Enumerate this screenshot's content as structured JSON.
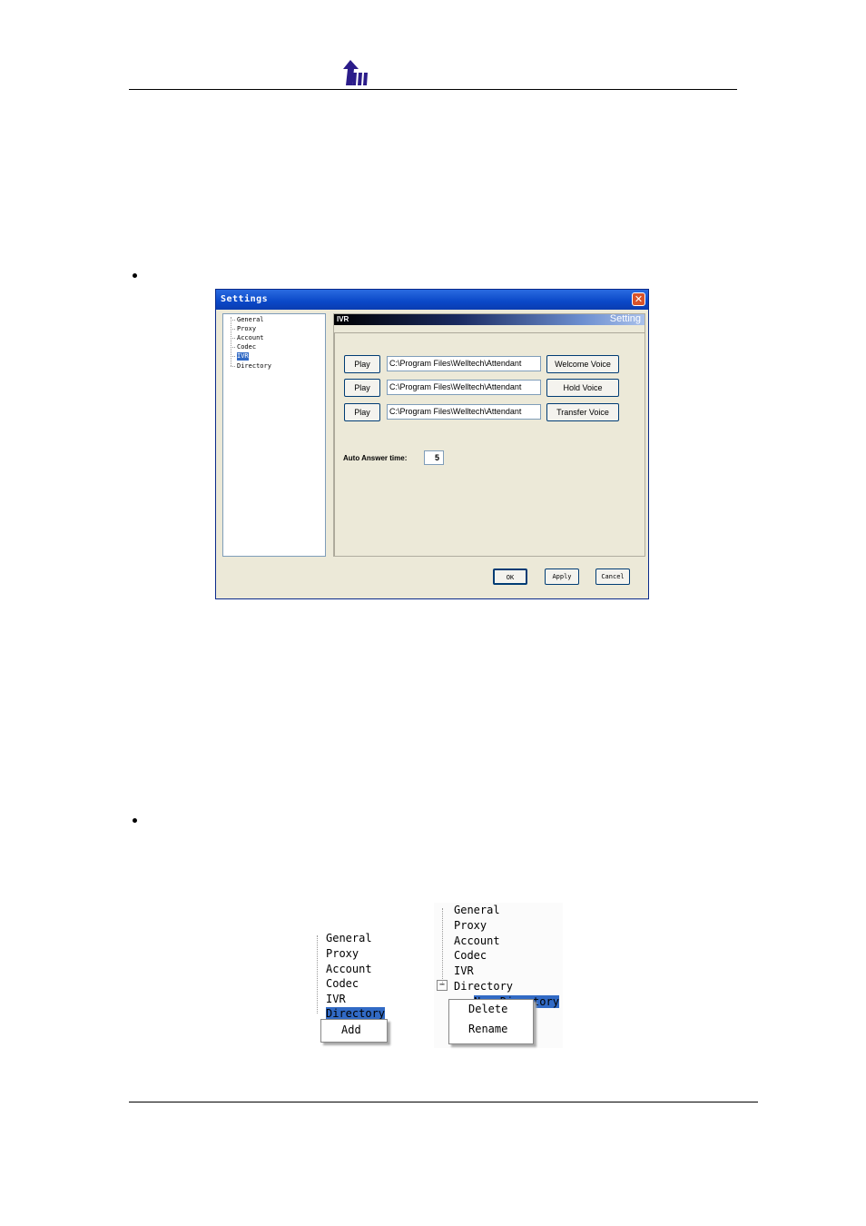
{
  "dialog": {
    "title": "Settings",
    "close_glyph": "✕",
    "tree": [
      "General",
      "Proxy",
      "Account",
      "Codec",
      "IVR",
      "Directory"
    ],
    "selected_tree_item": "IVR",
    "panel_header_left": "IVR",
    "panel_header_right": "Setting",
    "rows": [
      {
        "play": "Play",
        "path": "C:\\Program Files\\Welltech\\Attendant",
        "voice": "Welcome Voice"
      },
      {
        "play": "Play",
        "path": "C:\\Program Files\\Welltech\\Attendant",
        "voice": "Hold Voice"
      },
      {
        "play": "Play",
        "path": "C:\\Program Files\\Welltech\\Attendant",
        "voice": "Transfer Voice"
      }
    ],
    "auto_answer_label": "Auto Answer time:",
    "auto_answer_value": "5",
    "ok": "OK",
    "apply": "Apply",
    "cancel": "Cancel"
  },
  "menu_left": {
    "tree": [
      "General",
      "Proxy",
      "Account",
      "Codec",
      "IVR",
      "Directory"
    ],
    "selected": "Directory",
    "menu_items": [
      "Add"
    ]
  },
  "menu_right": {
    "tree": [
      "General",
      "Proxy",
      "Account",
      "Codec",
      "IVR",
      "Directory"
    ],
    "expander": "−",
    "child_selected": "New Directory",
    "menu_items": [
      "Delete",
      "Rename"
    ]
  }
}
